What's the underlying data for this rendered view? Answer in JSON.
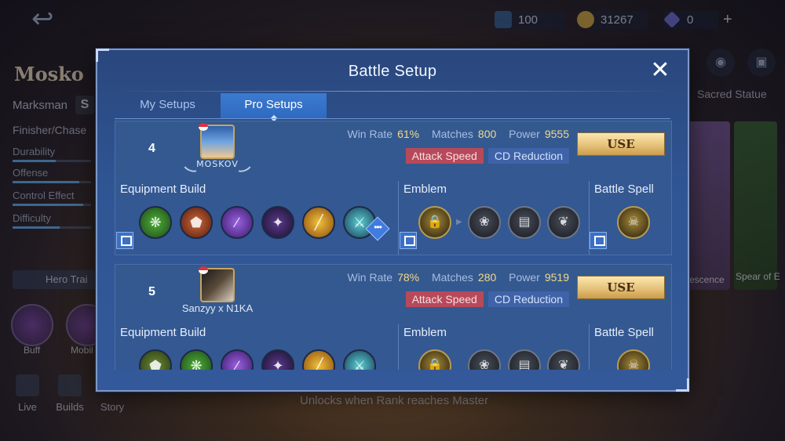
{
  "background": {
    "back_icon": "back-arrow-icon",
    "resources": {
      "tickets": "100",
      "coins": "31267",
      "diamonds": "0"
    },
    "hero": {
      "name": "Mosko",
      "role": "Marksman",
      "role_badge": "S",
      "tag": "Finisher/Chase",
      "stats": [
        {
          "label": "Durability",
          "level": 0.55
        },
        {
          "label": "Offense",
          "level": 0.85
        },
        {
          "label": "Control Effect",
          "level": 0.9
        },
        {
          "label": "Difficulty",
          "level": 0.6
        }
      ]
    },
    "hero_train": "Hero Trai",
    "skills": [
      "Buff",
      "Mobil"
    ],
    "nav": [
      "Live",
      "Builds",
      "Story"
    ],
    "sacred_statue": "Sacred Statue",
    "right_cards": [
      "escence",
      "Spear of E"
    ],
    "unlock_text": "Unlocks when Rank reaches Master"
  },
  "modal": {
    "title": "Battle Setup",
    "close_icon": "close-icon",
    "tabs": [
      {
        "label": "My Setups",
        "active": false
      },
      {
        "label": "Pro Setups",
        "active": true
      }
    ],
    "labels": {
      "win_rate": "Win Rate",
      "matches": "Matches",
      "power": "Power",
      "use": "USE",
      "equipment": "Equipment Build",
      "emblem": "Emblem",
      "spell": "Battle Spell"
    },
    "setups": [
      {
        "rank": "4",
        "player": "MOSKOV",
        "win_rate": "61%",
        "matches": "800",
        "power": "9555",
        "tags": [
          "Attack Speed",
          "CD Reduction"
        ],
        "items": [
          "windtalker-icon",
          "swift-boots-icon",
          "demon-hunter-sword-icon",
          "corrosion-scythe-icon",
          "golden-staff-icon",
          "malefic-roar-icon"
        ],
        "emblems": [
          "marksman-emblem-icon",
          "talent-icon",
          "talent-icon",
          "talent-icon"
        ],
        "spell": "retribution-icon"
      },
      {
        "rank": "5",
        "player": "Sanzyy x N1KA",
        "win_rate": "78%",
        "matches": "280",
        "power": "9519",
        "tags": [
          "Attack Speed",
          "CD Reduction"
        ],
        "items": [
          "boots-icon",
          "windtalker-icon",
          "demon-hunter-sword-icon",
          "corrosion-scythe-icon",
          "golden-staff-icon",
          "malefic-roar-icon"
        ],
        "emblems": [
          "marksman-emblem-icon",
          "talent-icon",
          "talent-icon",
          "talent-icon"
        ],
        "spell": "retribution-icon"
      }
    ]
  },
  "colors": {
    "modal_bg": "#2f5593",
    "tab_active": "#3b7bd0",
    "use_button": "#e6c27a",
    "stat_value": "#f2d98a",
    "tag_attack_speed": "#b8495a",
    "tag_cd_reduction": "#3f63a8"
  }
}
